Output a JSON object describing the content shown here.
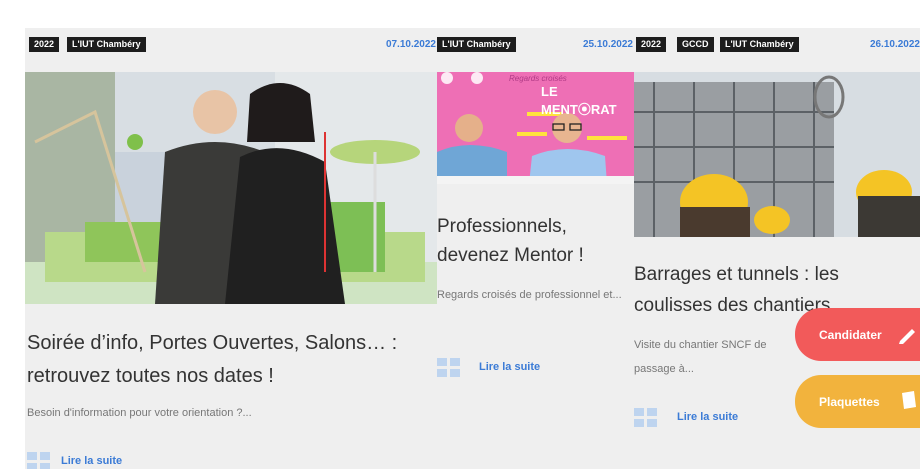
{
  "cards": [
    {
      "tags": [
        "2022",
        "L'IUT Chambéry"
      ],
      "date": "07.10.2022",
      "title": "Soirée d’info, Portes Ouvertes, Salons… : retrouvez toutes nos dates !",
      "excerpt": "Besoin d'information pour votre orientation ?...",
      "more": "Lire la suite"
    },
    {
      "tags": [
        "L'IUT Chambéry"
      ],
      "date": "25.10.2022",
      "image_text": {
        "top": "Regards croisés",
        "brand": "LE MENT⦿RAT"
      },
      "title": "Professionnels, devenez Mentor !",
      "excerpt": "Regards croisés de professionnel et...",
      "more": "Lire la suite"
    },
    {
      "tags": [
        "2022",
        "GCCD",
        "L'IUT Chambéry"
      ],
      "date": "26.10.2022",
      "title": "Barrages et tunnels : les coulisses des chantiers",
      "excerpt": "Visite du chantier SNCF de passage à...",
      "more": "Lire la suite"
    }
  ],
  "fabs": {
    "apply": "Candidater",
    "brochures": "Plaquettes"
  },
  "colors": {
    "tag_bg": "#1d1d1d",
    "date": "#3b7bd6",
    "link": "#3b7bd6",
    "apply": "#f25a5a",
    "brochures": "#f2b33d",
    "card_bg": "#efefef",
    "mentor_pink": "#ee6fb5"
  }
}
